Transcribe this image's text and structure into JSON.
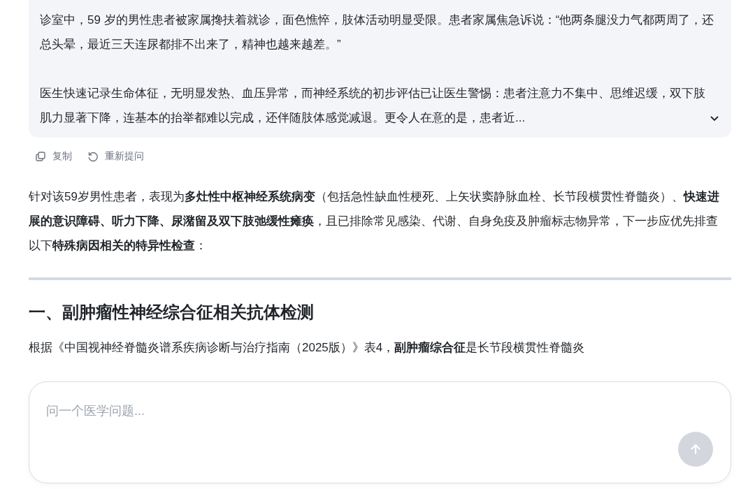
{
  "question_card": {
    "paragraphs": [
      "诊室中，59 岁的男性患者被家属搀扶着就诊，面色憔悴，肢体活动明显受限。患者家属焦急诉说：“他两条腿没力气都两周了，还总头晕，最近三天连尿都排不出来了，精神也越来越差。”",
      "医生快速记录生命体征，无明显发热、血压异常，而神经系统的初步评估已让医生警惕：患者注意力不集中、思维迟缓，双下肢肌力显著下降，连基本的抬举都难以完成，还伴随肢体感觉减退。更令人在意的是，患者近..."
    ],
    "expanded": false
  },
  "actions": [
    {
      "kind": "copy",
      "label": "复制"
    },
    {
      "kind": "retry",
      "label": "重新提问"
    }
  ],
  "answer": {
    "intro": "针对该59岁男性患者，表现为**多灶性中枢神经系统病变**（包括急性缺血性梗死、上矢状窦静脉血栓、长节段横贯性脊髓炎）、**快速进展的意识障碍、听力下降、尿潴留及双下肢弛缓性瘫痪**，且已排除常见感染、代谢、自身免疫及肿瘤标志物异常，下一步应优先排查以下**特殊病因相关的特异性检查**：",
    "heading": "一、副肿瘤性神经综合征相关抗体检测",
    "body": "根据《中国视神经脊髓炎谱系疾病诊断与治疗指南（2025版）》表4，**副肿瘤综合征**是长节段横贯性脊髓炎"
  },
  "composer": {
    "placeholder": "问一个医学问题...",
    "send_disabled": true
  }
}
